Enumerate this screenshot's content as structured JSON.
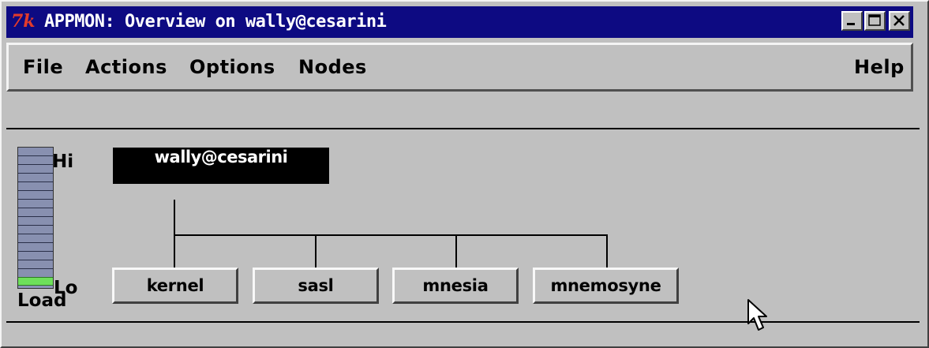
{
  "window": {
    "logo_text": "7k",
    "title": "APPMON: Overview on wally@cesarini"
  },
  "menu": {
    "items": [
      "File",
      "Actions",
      "Options",
      "Nodes"
    ],
    "help": "Help"
  },
  "load_meter": {
    "hi_label": "Hi",
    "lo_label": "Lo",
    "caption": "Load",
    "level": 0.06,
    "fill_color": "#6ee05a"
  },
  "node": {
    "name": "wally@cesarini"
  },
  "applications": [
    "kernel",
    "sasl",
    "mnesia",
    "mnemosyne"
  ],
  "colors": {
    "titlebar": "#0d0a82",
    "background": "#c0c0c0"
  }
}
